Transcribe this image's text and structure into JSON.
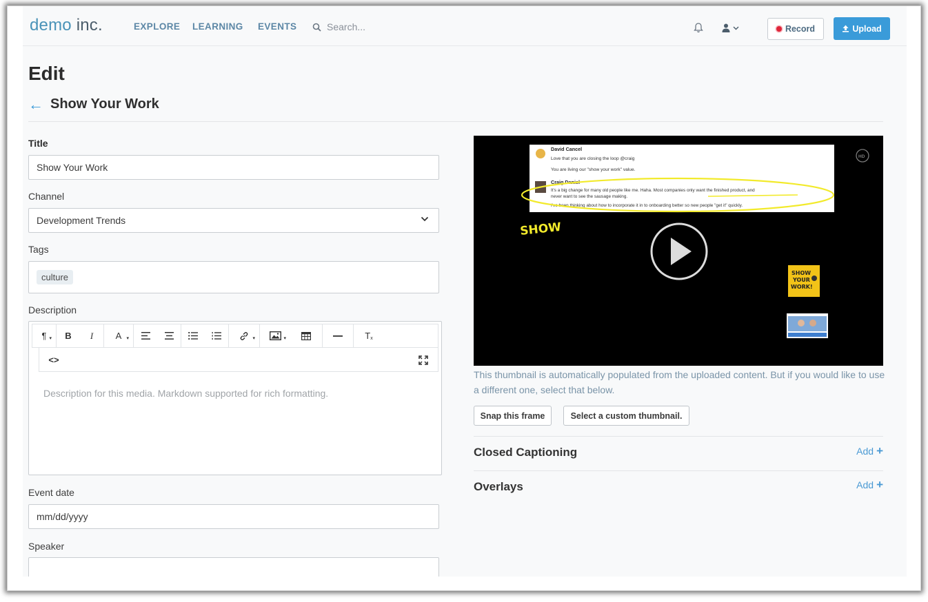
{
  "nav": {
    "logo_part1": "demo",
    "logo_part2": " inc.",
    "links": [
      "EXPLORE",
      "LEARNING",
      "EVENTS"
    ],
    "search_placeholder": "Search...",
    "record_label": "Record",
    "upload_label": "Upload"
  },
  "page": {
    "title": "Edit",
    "back_arrow": "←",
    "media_title": "Show Your Work"
  },
  "form": {
    "title_label": "Title",
    "title_value": "Show Your Work",
    "channel_label": "Channel",
    "channel_value": "Development Trends",
    "tags_label": "Tags",
    "tags": [
      "culture"
    ],
    "description_label": "Description",
    "description_placeholder": "Description for this media. Markdown supported for rich formatting.",
    "toolbar": {
      "paragraph": "¶",
      "bold": "B",
      "italic": "I",
      "font": "A",
      "clear_format": "T",
      "code": "<>"
    },
    "event_date_label": "Event date",
    "event_date_placeholder": "mm/dd/yyyy",
    "speaker_label": "Speaker",
    "speaker_value": ""
  },
  "thumbnail": {
    "hint": "This thumbnail is automatically populated from the uploaded content. But if you would like to use a different one, select that below.",
    "snap_label": "Snap this frame",
    "custom_label": "Select a custom thumbnail.",
    "video": {
      "msg1_author": "David Cancel",
      "msg1_line1": "Love that you are closing the loop @craig",
      "msg1_line2": "You are living our \"show your work\" value.",
      "msg2_author": "Craig Daniel",
      "msg2_line1": "It's a big change for many old people like me. Haha. Most companies only want the finished product, and",
      "msg2_line2": "never want to see the sausage making.",
      "msg2_line3": "I've been thinking about how to incorporate it in to onboarding better so new people \"get it\" quickly.",
      "handwriting": "SHOW",
      "hd_badge": "HD",
      "book_text_1": "SHOW",
      "book_text_2": "YOUR",
      "book_text_3": "WORK!"
    }
  },
  "sections": {
    "captioning_title": "Closed Captioning",
    "overlays_title": "Overlays",
    "add_label": "Add"
  }
}
